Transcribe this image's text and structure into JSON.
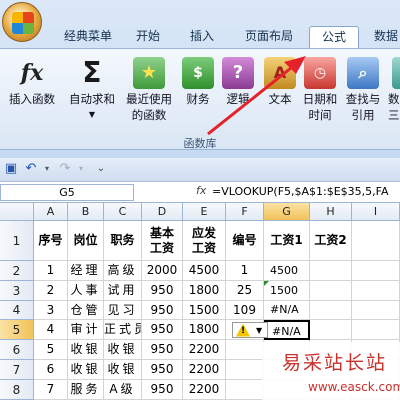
{
  "tabs": [
    "经典菜单",
    "开始",
    "插入",
    "页面布局",
    "公式",
    "数据"
  ],
  "commands": [
    {
      "line1": "插入函数",
      "line2": ""
    },
    {
      "line1": "自动求和",
      "line2": ""
    },
    {
      "line1": "最近使用",
      "line2": "的函数"
    },
    {
      "line1": "财务",
      "line2": ""
    },
    {
      "line1": "逻辑",
      "line2": ""
    },
    {
      "line1": "文本",
      "line2": ""
    },
    {
      "line1": "日期和",
      "line2": "时间"
    },
    {
      "line1": "查找与",
      "line2": "引用"
    },
    {
      "line1": "数",
      "line2": "三"
    }
  ],
  "group_label": "函数库",
  "namebox": "G5",
  "formula": "=VLOOKUP(F5,$A$1:$E$35,5,FA",
  "columns": [
    "A",
    "B",
    "C",
    "D",
    "E",
    "F",
    "G",
    "H",
    "I"
  ],
  "rows": [
    "1",
    "2",
    "3",
    "4",
    "5",
    "6",
    "7",
    "8"
  ],
  "header_row": [
    "序号",
    "岗位",
    "职务",
    "基本\n工资",
    "应发\n工资",
    "编号",
    "工资1",
    "工资2",
    ""
  ],
  "data": [
    [
      "1",
      "经理",
      "高级",
      "2000",
      "4500",
      "1",
      "4500",
      "",
      ""
    ],
    [
      "2",
      "人事",
      "试用",
      "950",
      "1800",
      "25",
      "1500",
      "",
      ""
    ],
    [
      "3",
      "仓管",
      "见习",
      "950",
      "1500",
      "109",
      "#N/A",
      "",
      ""
    ],
    [
      "4",
      "审计",
      "正式员",
      "950",
      "1800",
      "",
      "#N/A",
      "",
      ""
    ],
    [
      "5",
      "收银",
      "收银",
      "950",
      "2200",
      "",
      "",
      "",
      ""
    ],
    [
      "6",
      "收银",
      "收银",
      "950",
      "2200",
      "",
      "",
      "",
      ""
    ],
    [
      "7",
      "服务",
      "A级",
      "950",
      "2200",
      "",
      "",
      "",
      ""
    ]
  ],
  "watermark": {
    "title": "易采站长站",
    "url": "www.easck.com"
  },
  "warning_icon": "!",
  "colors": {
    "accent": "#e5212b",
    "selected_header": "#f2c25a"
  }
}
